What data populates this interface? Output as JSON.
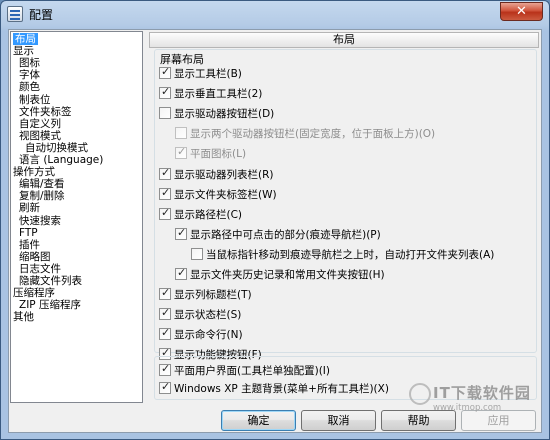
{
  "window": {
    "title": "配置",
    "close_label": "✕"
  },
  "tree": {
    "items": [
      {
        "label": "布局",
        "indent": 0,
        "selected": true
      },
      {
        "label": "显示",
        "indent": 0
      },
      {
        "label": "图标",
        "indent": 1
      },
      {
        "label": "字体",
        "indent": 1
      },
      {
        "label": "颜色",
        "indent": 1
      },
      {
        "label": "制表位",
        "indent": 1
      },
      {
        "label": "文件夹标签",
        "indent": 1
      },
      {
        "label": "自定义列",
        "indent": 1
      },
      {
        "label": "视图模式",
        "indent": 1
      },
      {
        "label": "自动切换模式",
        "indent": 2
      },
      {
        "label": "语言 (Language)",
        "indent": 1
      },
      {
        "label": "操作方式",
        "indent": 0
      },
      {
        "label": "编辑/查看",
        "indent": 1
      },
      {
        "label": "复制/删除",
        "indent": 1
      },
      {
        "label": "刷新",
        "indent": 1
      },
      {
        "label": "快速搜索",
        "indent": 1
      },
      {
        "label": "FTP",
        "indent": 1
      },
      {
        "label": "插件",
        "indent": 1
      },
      {
        "label": "缩略图",
        "indent": 1
      },
      {
        "label": "日志文件",
        "indent": 1
      },
      {
        "label": "隐藏文件列表",
        "indent": 1
      },
      {
        "label": "压缩程序",
        "indent": 0
      },
      {
        "label": "ZIP 压缩程序",
        "indent": 1
      },
      {
        "label": "其他",
        "indent": 0
      }
    ]
  },
  "panel": {
    "header": "布局",
    "group_title": "屏幕布局",
    "options": [
      {
        "label": "显示工具栏(B)",
        "checked": true,
        "level": 0
      },
      {
        "label": "显示垂直工具栏(2)",
        "checked": true,
        "level": 0
      },
      {
        "label": "显示驱动器按钮栏(D)",
        "checked": false,
        "level": 0
      },
      {
        "label": "显示两个驱动器按钮栏(固定宽度，位于面板上方)(O)",
        "checked": false,
        "level": 1,
        "disabled": true
      },
      {
        "label": "平面图标(L)",
        "checked": true,
        "level": 1,
        "disabled": true
      },
      {
        "label": "显示驱动器列表栏(R)",
        "checked": true,
        "level": 0
      },
      {
        "label": "显示文件夹标签栏(W)",
        "checked": true,
        "level": 0
      },
      {
        "label": "显示路径栏(C)",
        "checked": true,
        "level": 0
      },
      {
        "label": "显示路径中可点击的部分(痕迹导航栏)(P)",
        "checked": true,
        "level": 1
      },
      {
        "label": "当鼠标指针移动到痕迹导航栏之上时，自动打开文件夹列表(A)",
        "checked": false,
        "level": 2
      },
      {
        "label": "显示文件夹历史记录和常用文件夹按钮(H)",
        "checked": true,
        "level": 1
      },
      {
        "label": "显示列标题栏(T)",
        "checked": true,
        "level": 0
      },
      {
        "label": "显示状态栏(S)",
        "checked": true,
        "level": 0
      },
      {
        "label": "显示命令行(N)",
        "checked": true,
        "level": 0
      },
      {
        "label": "显示功能键按钮(F)",
        "checked": true,
        "level": 0
      }
    ],
    "options2": [
      {
        "label": "平面用户界面(工具栏单独配置)(I)",
        "checked": true
      },
      {
        "label": "Windows XP 主题背景(菜单+所有工具栏)(X)",
        "checked": true
      }
    ]
  },
  "buttons": {
    "ok": "确定",
    "cancel": "取消",
    "help": "帮助",
    "apply": "应用"
  },
  "watermark": {
    "title": "IT下载软件园",
    "url": "www.itmop.com"
  }
}
